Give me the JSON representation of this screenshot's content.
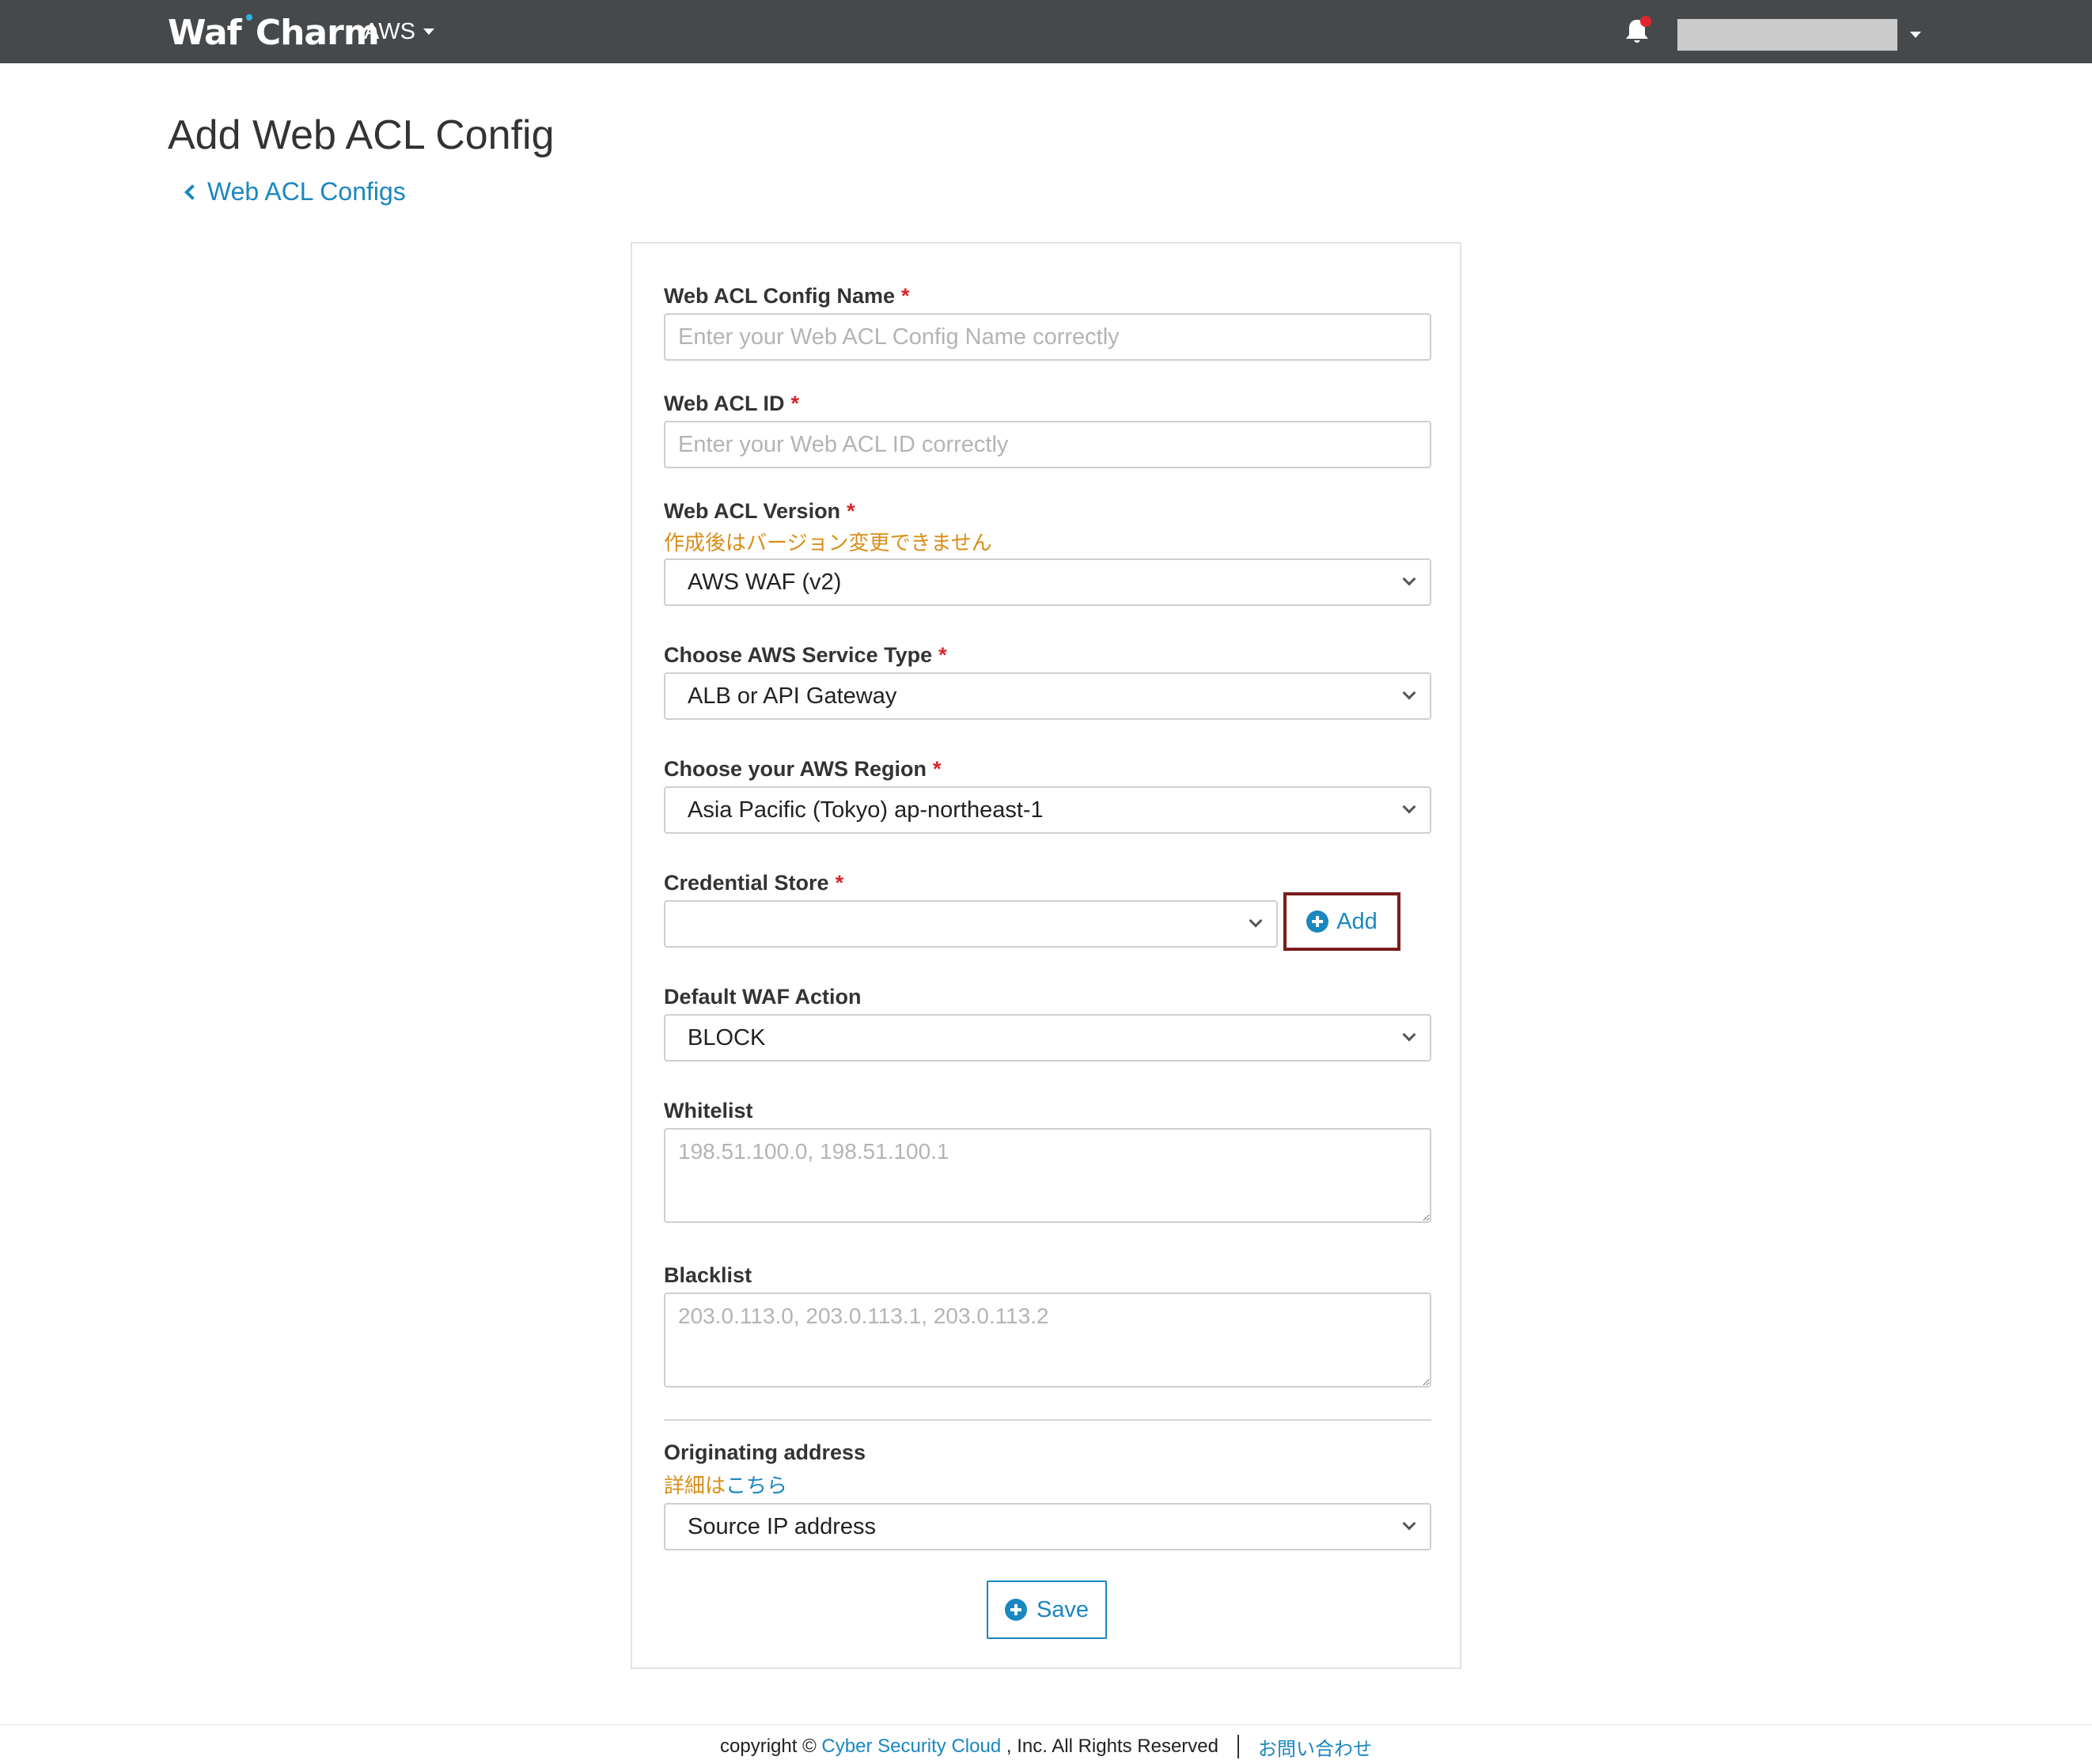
{
  "header": {
    "brand_part1": "Waf",
    "brand_part2": "Charm",
    "cloud_label": "AWS",
    "bell_icon": "bell-icon",
    "brand_color": "#2fb3e0",
    "navbar_color": "#45494b"
  },
  "page": {
    "title": "Add Web ACL Config",
    "back_link": "Web ACL Configs"
  },
  "form": {
    "config_name": {
      "label": "Web ACL Config Name",
      "required": "*",
      "placeholder": "Enter your Web ACL Config Name correctly",
      "value": ""
    },
    "acl_id": {
      "label": "Web ACL ID",
      "required": "*",
      "placeholder": "Enter your Web ACL ID correctly",
      "value": ""
    },
    "acl_version": {
      "label": "Web ACL Version",
      "required": "*",
      "note": "作成後はバージョン変更できません",
      "value": "AWS WAF (v2)"
    },
    "service_type": {
      "label": "Choose AWS Service Type",
      "required": "*",
      "value": "ALB or API Gateway"
    },
    "region": {
      "label": "Choose your AWS Region",
      "required": "*",
      "value": "Asia Pacific (Tokyo) ap-northeast-1"
    },
    "credential_store": {
      "label": "Credential Store",
      "required": "*",
      "value": "",
      "add_label": "Add"
    },
    "default_action": {
      "label": "Default WAF Action",
      "value": "BLOCK"
    },
    "whitelist": {
      "label": "Whitelist",
      "placeholder": "198.51.100.0, 198.51.100.1"
    },
    "blacklist": {
      "label": "Blacklist",
      "placeholder": "203.0.113.0, 203.0.113.1, 203.0.113.2"
    },
    "originating_address": {
      "label": "Originating address",
      "note_prefix": "詳細は",
      "note_link": "こちら",
      "value": "Source IP address"
    },
    "save_label": "Save"
  },
  "footer": {
    "prefix": "copyright ©",
    "company_link": "Cyber Security Cloud",
    "suffix": ", Inc. All Rights Reserved",
    "contact_link": "お問い合わせ"
  },
  "colors": {
    "accent": "#1a87c1",
    "required": "#d9232a",
    "note": "#d98e18",
    "highlight_border": "#7a1c1c"
  }
}
